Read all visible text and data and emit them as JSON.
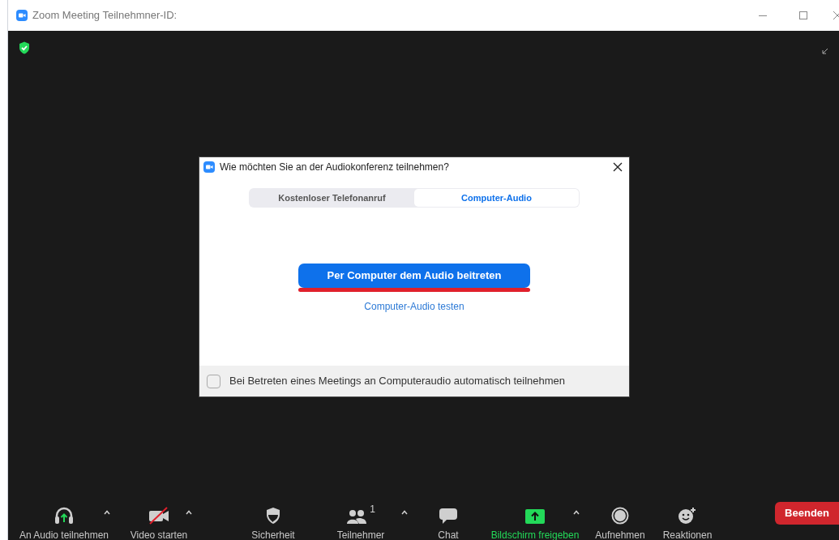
{
  "window": {
    "title": "Zoom Meeting Teilnehmner-ID:"
  },
  "dialog": {
    "title": "Wie möchten Sie an der Audiokonferenz teilnehmen?",
    "tabs": [
      {
        "label": "Kostenloser Telefonanruf",
        "selected": false
      },
      {
        "label": "Computer-Audio",
        "selected": true
      }
    ],
    "join_button": "Per Computer dem Audio beitreten",
    "test_link": "Computer-Audio testen",
    "auto_join": {
      "label": "Bei Betreten eines Meetings an Computeraudio automatisch teilnehmen",
      "checked": false
    }
  },
  "toolbar": {
    "items": [
      {
        "kind": "audio",
        "label": "An Audio teilnehmen",
        "menu": true,
        "highlighted": false
      },
      {
        "kind": "video",
        "label": "Video starten",
        "menu": true,
        "highlighted": false
      },
      {
        "kind": "security",
        "label": "Sicherheit",
        "menu": false,
        "highlighted": false
      },
      {
        "kind": "participants",
        "label": "Teilnehmer",
        "count": "1",
        "menu": true,
        "highlighted": false
      },
      {
        "kind": "chat",
        "label": "Chat",
        "menu": false,
        "highlighted": false
      },
      {
        "kind": "share",
        "label": "Bildschirm freigeben",
        "menu": true,
        "highlighted": true
      },
      {
        "kind": "record",
        "label": "Aufnehmen",
        "menu": false,
        "highlighted": false
      },
      {
        "kind": "reactions",
        "label": "Reaktionen",
        "menu": false,
        "highlighted": false
      }
    ],
    "end_button": "Beenden"
  }
}
